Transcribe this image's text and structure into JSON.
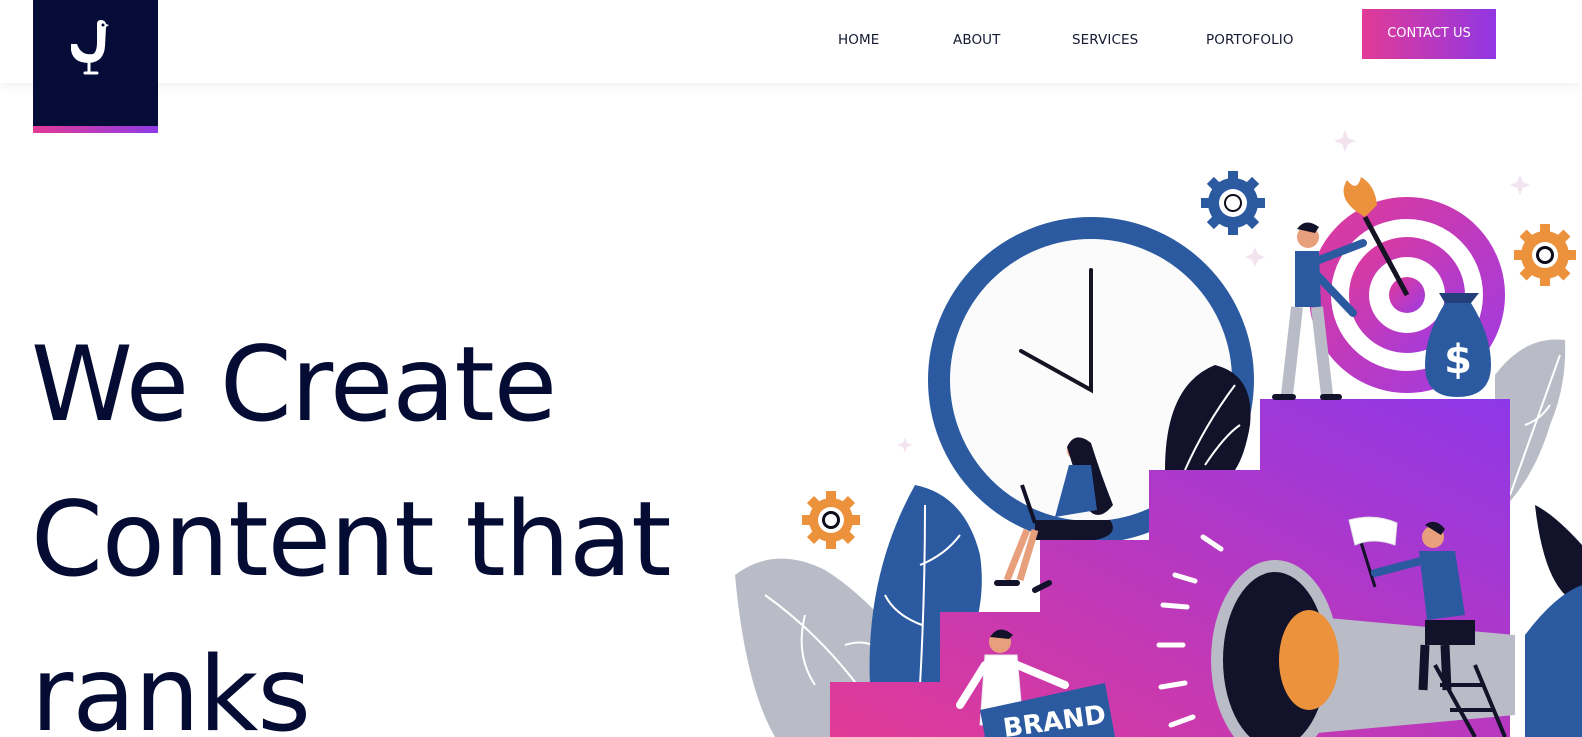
{
  "nav": {
    "home": "HOME",
    "about": "ABOUT",
    "services": "SERVICES",
    "portfolio": "PORTOFOLIO",
    "contact": "CONTACT US"
  },
  "hero": {
    "line1": "We Create",
    "line2": "Content that",
    "line3": "ranks"
  },
  "illustration": {
    "sign_text": "BRAND",
    "bag_symbol": "$"
  },
  "colors": {
    "navy": "#050c38",
    "pink": "#e23a96",
    "purple": "#9137e3",
    "blue": "#2b5aa0",
    "orange": "#ec913c",
    "gray": "#b9bcc6"
  }
}
